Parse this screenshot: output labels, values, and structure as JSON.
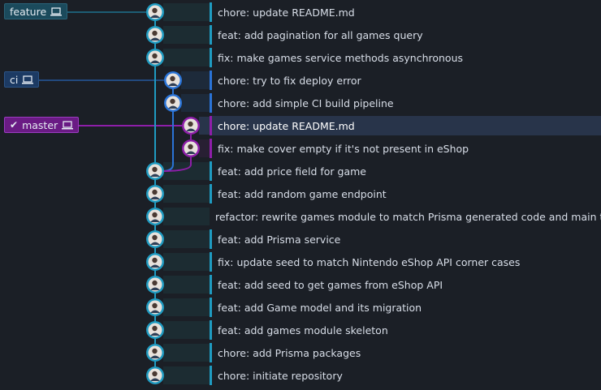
{
  "colors": {
    "feature": "#1f9bc1",
    "ci": "#2a73d6",
    "master": "#8e1ea9",
    "master_label_bg": "#6a1b84",
    "feature_label_bg": "#1b4a5c",
    "ci_label_bg": "#1c3a63"
  },
  "branches": {
    "feature": {
      "label": "feature",
      "icon": "laptop-icon"
    },
    "ci": {
      "label": "ci",
      "icon": "laptop-icon"
    },
    "master": {
      "label": "master",
      "icon": "laptop-icon",
      "checked": true,
      "check_icon": "check-icon"
    }
  },
  "commits": [
    {
      "message": "chore: update README.md",
      "branch": "feature",
      "lane": 0
    },
    {
      "message": "feat: add pagination for all games query",
      "branch": "feature",
      "lane": 0
    },
    {
      "message": "fix: make games service methods asynchronous",
      "branch": "feature",
      "lane": 0
    },
    {
      "message": "chore: try to fix deploy error",
      "branch": "ci",
      "lane": 1
    },
    {
      "message": "chore: add simple CI build pipeline",
      "branch": "ci",
      "lane": 1
    },
    {
      "message": "chore: update README.md",
      "branch": "master",
      "lane": 2,
      "selected": true
    },
    {
      "message": "fix: make cover empty if it's not present in eShop",
      "branch": "master",
      "lane": 2
    },
    {
      "message": "feat: add price field for game",
      "branch": "feature",
      "lane": 0
    },
    {
      "message": "feat: add random game endpoint",
      "branch": "feature",
      "lane": 0
    },
    {
      "message": "refactor: rewrite games module to match Prisma generated code and main task",
      "branch": "feature",
      "lane": 0
    },
    {
      "message": "feat: add Prisma service",
      "branch": "feature",
      "lane": 0
    },
    {
      "message": "fix: update seed to match Nintendo eShop API corner cases",
      "branch": "feature",
      "lane": 0
    },
    {
      "message": "feat: add seed to get games from eShop API",
      "branch": "feature",
      "lane": 0
    },
    {
      "message": "feat: add Game model and its migration",
      "branch": "feature",
      "lane": 0
    },
    {
      "message": "feat: add games module skeleton",
      "branch": "feature",
      "lane": 0
    },
    {
      "message": "chore: add Prisma packages",
      "branch": "feature",
      "lane": 0
    },
    {
      "message": "chore: initiate repository",
      "branch": "feature",
      "lane": 0
    }
  ]
}
